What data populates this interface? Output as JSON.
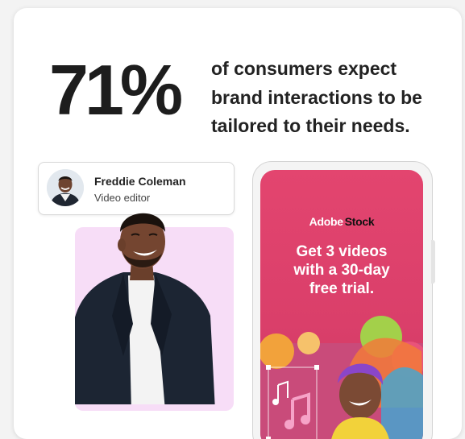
{
  "stat": {
    "value": "71%",
    "text": "of consumers expect brand interactions to be tailored to their needs."
  },
  "profile": {
    "name": "Freddie Coleman",
    "role": "Video editor"
  },
  "phone": {
    "brand_part1": "Adobe",
    "brand_part2": "Stock",
    "promo_line1": "Get 3 videos",
    "promo_line2": "with a 30-day",
    "promo_line3": "free trial."
  },
  "colors": {
    "accent_pink": "#e3456f",
    "photo_background": "#f7ddf7",
    "text_dark": "#1d1d1d"
  }
}
